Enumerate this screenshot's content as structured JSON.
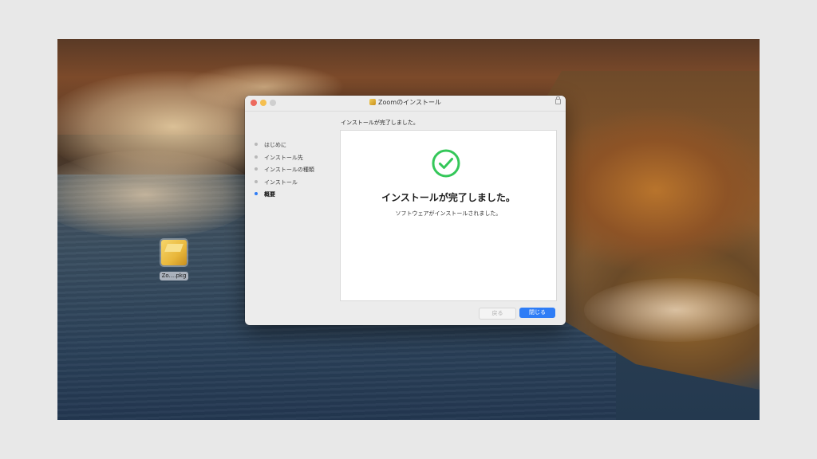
{
  "desktop": {
    "file_label": "Zo....pkg"
  },
  "window": {
    "title": "Zoomのインストール",
    "heading": "インストールが完了しました。",
    "steps": [
      {
        "label": "はじめに",
        "active": false
      },
      {
        "label": "インストール先",
        "active": false
      },
      {
        "label": "インストールの種類",
        "active": false
      },
      {
        "label": "インストール",
        "active": false
      },
      {
        "label": "概要",
        "active": true
      }
    ],
    "result": {
      "title": "インストールが完了しました。",
      "subtitle": "ソフトウェアがインストールされました。"
    },
    "buttons": {
      "back": "戻る",
      "close": "閉じる"
    }
  },
  "colors": {
    "accent": "#2f7df6",
    "success": "#34c759"
  }
}
